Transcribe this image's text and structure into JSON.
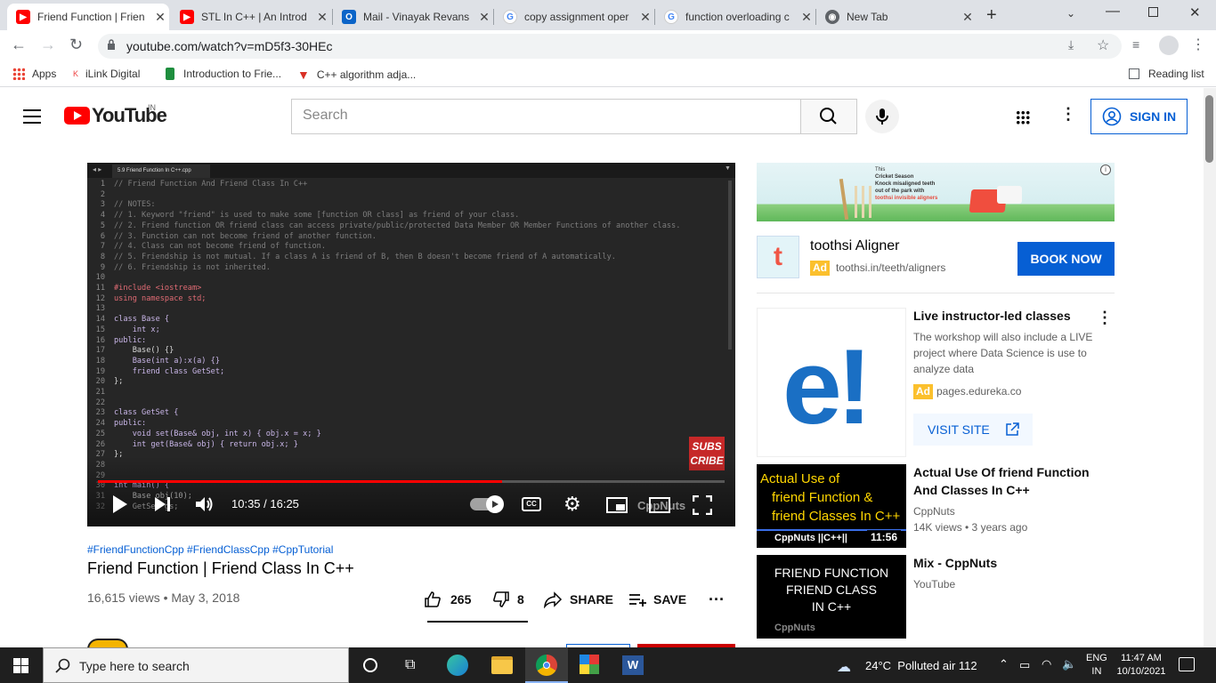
{
  "browser": {
    "tabs": [
      {
        "title": "Friend Function | Frien",
        "favicon": "youtube-icon",
        "active": true
      },
      {
        "title": "STL In C++ | An Introd",
        "favicon": "youtube-icon",
        "active": false
      },
      {
        "title": "Mail - Vinayak Revans",
        "favicon": "outlook-icon",
        "active": false
      },
      {
        "title": "copy assignment oper",
        "favicon": "google-icon",
        "active": false
      },
      {
        "title": "function overloading c",
        "favicon": "google-icon",
        "active": false
      },
      {
        "title": "New Tab",
        "favicon": "chrome-icon",
        "active": false
      }
    ],
    "url": "youtube.com/watch?v=mD5f3-30HEc",
    "bookmarks": [
      "Apps",
      "iLink Digital",
      "Introduction to Frie...",
      "C++ algorithm adja..."
    ],
    "reading_list": "Reading list"
  },
  "youtube": {
    "logo": "YouTube",
    "region": "IN",
    "search_placeholder": "Search",
    "sign_in": "SIGN IN"
  },
  "player": {
    "file_tab": "5.9 Friend Function In C++.cpp",
    "code_lines": [
      {
        "n": "1",
        "t": "// Friend Function And Friend Class In C++"
      },
      {
        "n": "2",
        "t": ""
      },
      {
        "n": "3",
        "t": "// NOTES:"
      },
      {
        "n": "4",
        "t": "// 1. Keyword \"friend\" is used to make some [function OR class] as friend of your class."
      },
      {
        "n": "5",
        "t": "// 2. Friend function OR friend class can access private/public/protected Data Member OR Member Functions of another class."
      },
      {
        "n": "6",
        "t": "// 3. Function can not become friend of another function."
      },
      {
        "n": "7",
        "t": "// 4. Class can not become friend of function."
      },
      {
        "n": "8",
        "t": "// 5. Friendship is not mutual. If a class A is friend of B, then B doesn't become friend of A automatically."
      },
      {
        "n": "9",
        "t": "// 6. Friendship is not inherited."
      },
      {
        "n": "10",
        "t": ""
      },
      {
        "n": "11",
        "t": "#include <iostream>"
      },
      {
        "n": "12",
        "t": "using namespace std;"
      },
      {
        "n": "13",
        "t": ""
      },
      {
        "n": "14",
        "t": "class Base {"
      },
      {
        "n": "15",
        "t": "    int x;"
      },
      {
        "n": "16",
        "t": "public:"
      },
      {
        "n": "17",
        "t": "    Base() {}"
      },
      {
        "n": "18",
        "t": "    Base(int a):x(a) {}"
      },
      {
        "n": "19",
        "t": "    friend class GetSet;"
      },
      {
        "n": "20",
        "t": "};"
      },
      {
        "n": "21",
        "t": ""
      },
      {
        "n": "22",
        "t": ""
      },
      {
        "n": "23",
        "t": "class GetSet {"
      },
      {
        "n": "24",
        "t": "public:"
      },
      {
        "n": "25",
        "t": "    void set(Base& obj, int x) { obj.x = x; }"
      },
      {
        "n": "26",
        "t": "    int get(Base& obj) { return obj.x; }"
      },
      {
        "n": "27",
        "t": "};"
      },
      {
        "n": "28",
        "t": ""
      },
      {
        "n": "29",
        "t": ""
      },
      {
        "n": "30",
        "t": "int main() {"
      },
      {
        "n": "31",
        "t": "    Base obj(10);"
      },
      {
        "n": "32",
        "t": "    GetSet gs;"
      }
    ],
    "subscribe_badge": "SUBS CRIBE",
    "time": "10:35 / 16:25",
    "watermark": "CppNuts",
    "progress": 0.645
  },
  "video": {
    "hashtags": "#FriendFunctionCpp #FriendClassCpp #CppTutorial",
    "title": "Friend Function | Friend Class In C++",
    "views_date": "16,615 views • May 3, 2018",
    "likes": "265",
    "dislikes": "8",
    "share": "SHARE",
    "save": "SAVE"
  },
  "ad": {
    "banner_line1": "This",
    "banner_line2": "Cricket Season",
    "banner_line3": "Knock misaligned teeth",
    "banner_line4": "out of the park with",
    "banner_line5": "toothsi invisible aligners",
    "name": "toothsi Aligner",
    "ad_label": "Ad",
    "url": "toothsi.in/teeth/aligners",
    "cta": "BOOK NOW"
  },
  "sidebar": {
    "promo": {
      "title": "Live instructor-led classes",
      "desc": "The workshop will also include a LIVE project where Data Science is use to analyze data",
      "ad_label": "Ad",
      "url": "pages.edureka.co",
      "cta": "VISIT SITE"
    },
    "videos": [
      {
        "thumb_lines": [
          "Actual Use of",
          "friend Function &",
          "friend Classes In C++"
        ],
        "thumb_channel": "CppNuts ||C++||",
        "duration": "11:56",
        "title": "Actual Use Of friend Function And Classes In C++",
        "channel": "CppNuts",
        "meta": "14K views • 3 years ago"
      },
      {
        "thumb_lines": [
          "FRIEND FUNCTION",
          "FRIEND CLASS",
          "IN C++"
        ],
        "thumb_channel": "CppNuts",
        "title": "Mix - CppNuts",
        "channel": "YouTube"
      }
    ]
  },
  "taskbar": {
    "search": "Type here to search",
    "weather": "24°C  Polluted air 112",
    "lang1": "ENG",
    "lang2": "IN",
    "time": "11:47 AM",
    "date": "10/10/2021"
  }
}
